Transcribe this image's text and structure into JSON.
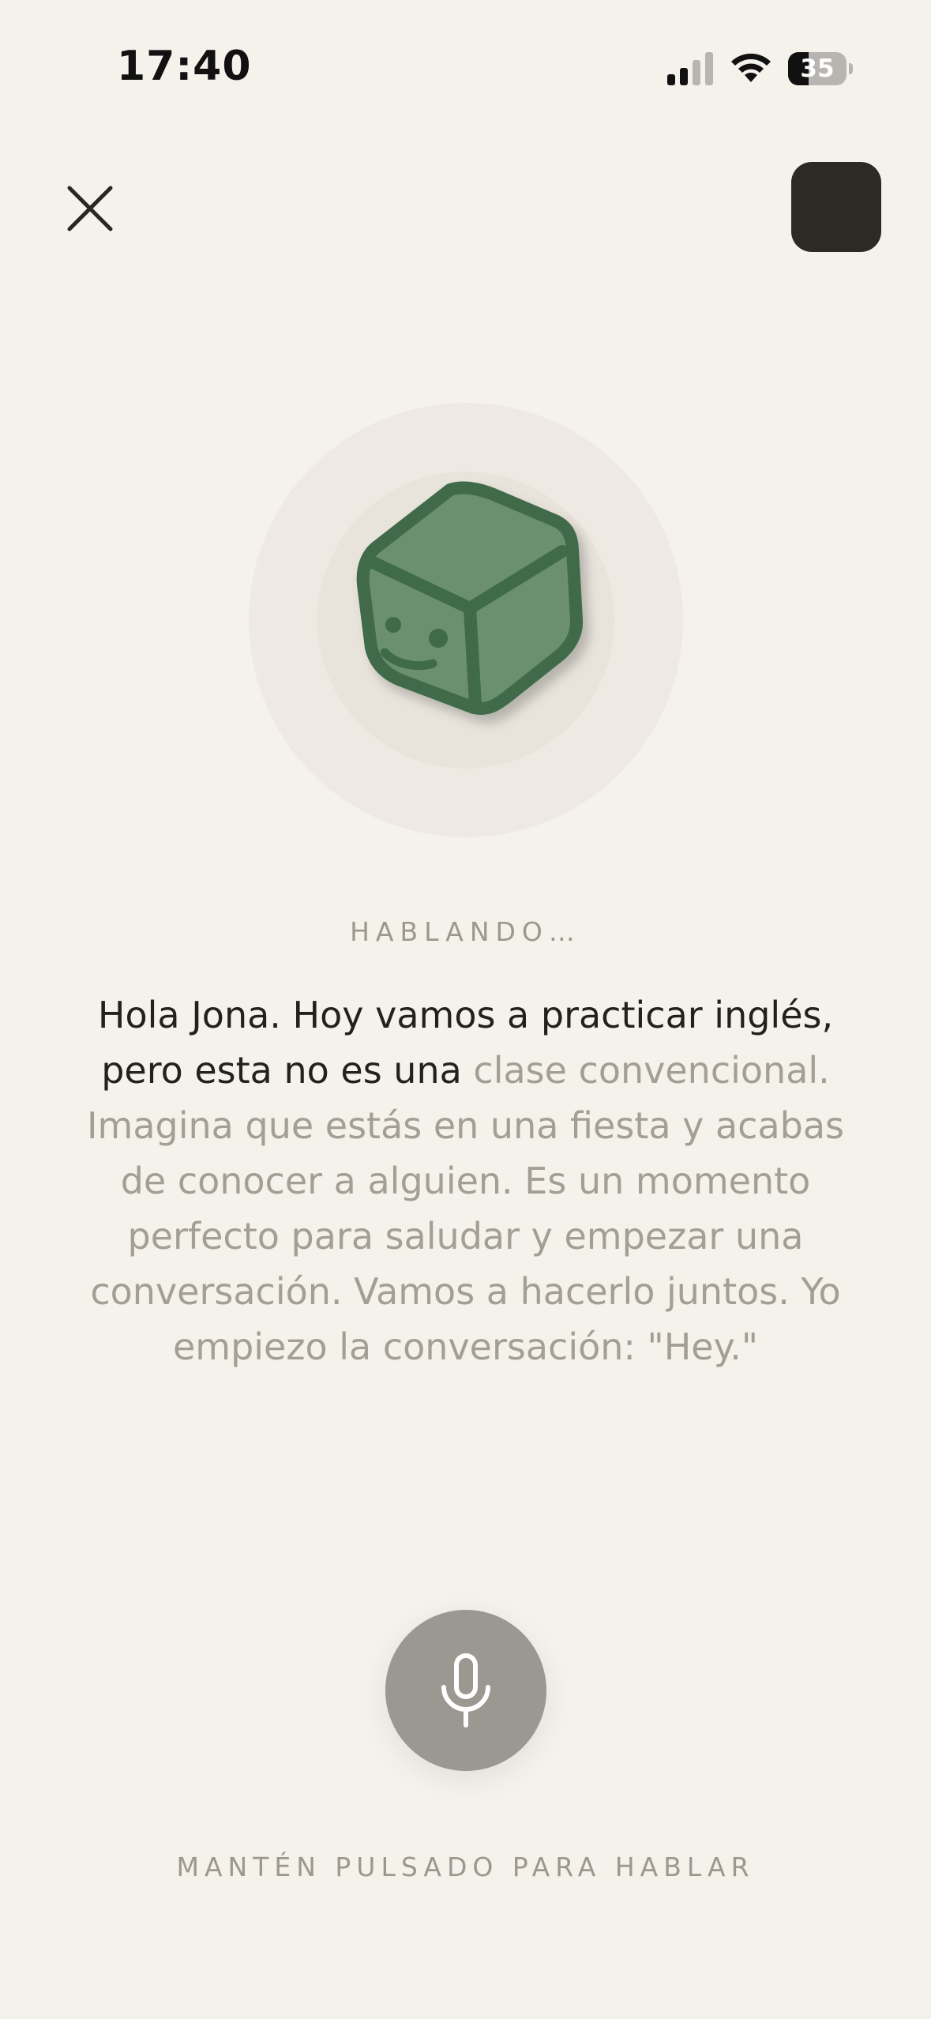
{
  "status_bar": {
    "time": "17:40",
    "battery_level": "35",
    "battery_fraction": 0.35
  },
  "header": {
    "close_icon": "close-icon",
    "menu_icon": "menu-square"
  },
  "avatar": {
    "icon": "smiling-cube-icon",
    "color": "#6b8f71",
    "outline_color": "#3f6b48"
  },
  "status_label": "HABLANDO…",
  "message": {
    "spoken": "Hola Jona. Hoy vamos a practicar inglés, pero esta no es una",
    "pending": " clase convencional. Imagina que estás en una fiesta y acabas de conocer a alguien. Es un momento perfecto para saludar y empezar una conversación. Vamos a hacerlo juntos. Yo empiezo la conversación: \"Hey.\""
  },
  "mic": {
    "icon": "microphone-icon",
    "hint": "MANTÉN PULSADO PARA HABLAR"
  },
  "colors": {
    "background": "#f5f1eb",
    "text_dark": "#24211d",
    "text_muted": "#a39e96",
    "mic_button": "#9b9791"
  }
}
